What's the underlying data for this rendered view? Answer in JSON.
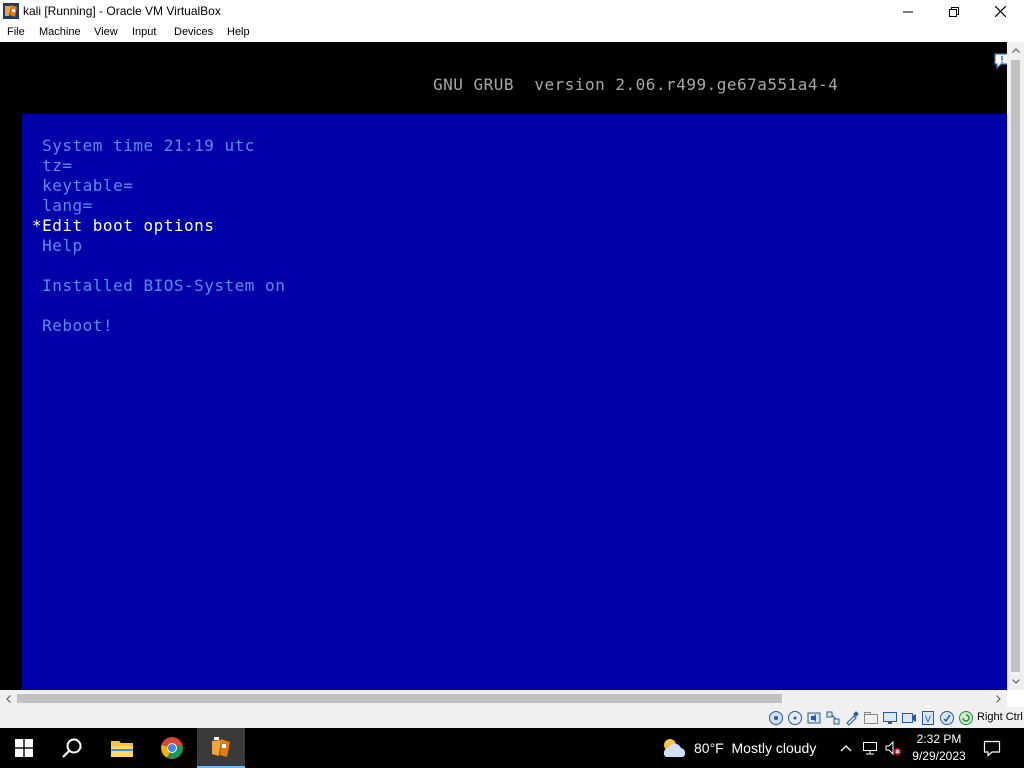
{
  "window": {
    "title": "kali [Running] - Oracle VM VirtualBox",
    "icon": "virtualbox-icon"
  },
  "menu": {
    "items": [
      "File",
      "Machine",
      "View",
      "Input",
      "Devices",
      "Help"
    ]
  },
  "vm_screen": {
    "header": "GNU GRUB  version 2.06.r499.ge67a551a4-4",
    "entries": [
      {
        "label": " System time 21:19 utc",
        "selected": false
      },
      {
        "label": " tz=",
        "selected": false
      },
      {
        "label": " keytable=",
        "selected": false
      },
      {
        "label": " lang=",
        "selected": false
      },
      {
        "label": "*Edit boot options",
        "selected": true
      },
      {
        "label": " Help",
        "selected": false
      },
      {
        "label": " Installed BIOS-System on",
        "selected": false
      },
      {
        "label": " Reboot!",
        "selected": false
      }
    ],
    "colors": {
      "background": "#0000a8",
      "text": "#5a8cf0",
      "selected_text": "#ffffff",
      "header_text": "#a8a8a8"
    }
  },
  "statusbar": {
    "icons": [
      "hard-disk-icon",
      "optical-drive-icon",
      "audio-icon",
      "network-icon",
      "usb-icon",
      "shared-folders-icon",
      "display-icon",
      "recording-icon",
      "virtualization-icon",
      "mouse-integration-icon",
      "keyboard-icon"
    ],
    "host_key": "Right Ctrl"
  },
  "taskbar": {
    "apps": [
      "start-button",
      "search-icon",
      "file-explorer-icon",
      "chrome-icon",
      "virtualbox-icon"
    ],
    "weather": {
      "temperature": "80°F",
      "condition": "Mostly cloudy"
    },
    "clock": {
      "time": "2:32 PM",
      "date": "9/29/2023"
    }
  }
}
